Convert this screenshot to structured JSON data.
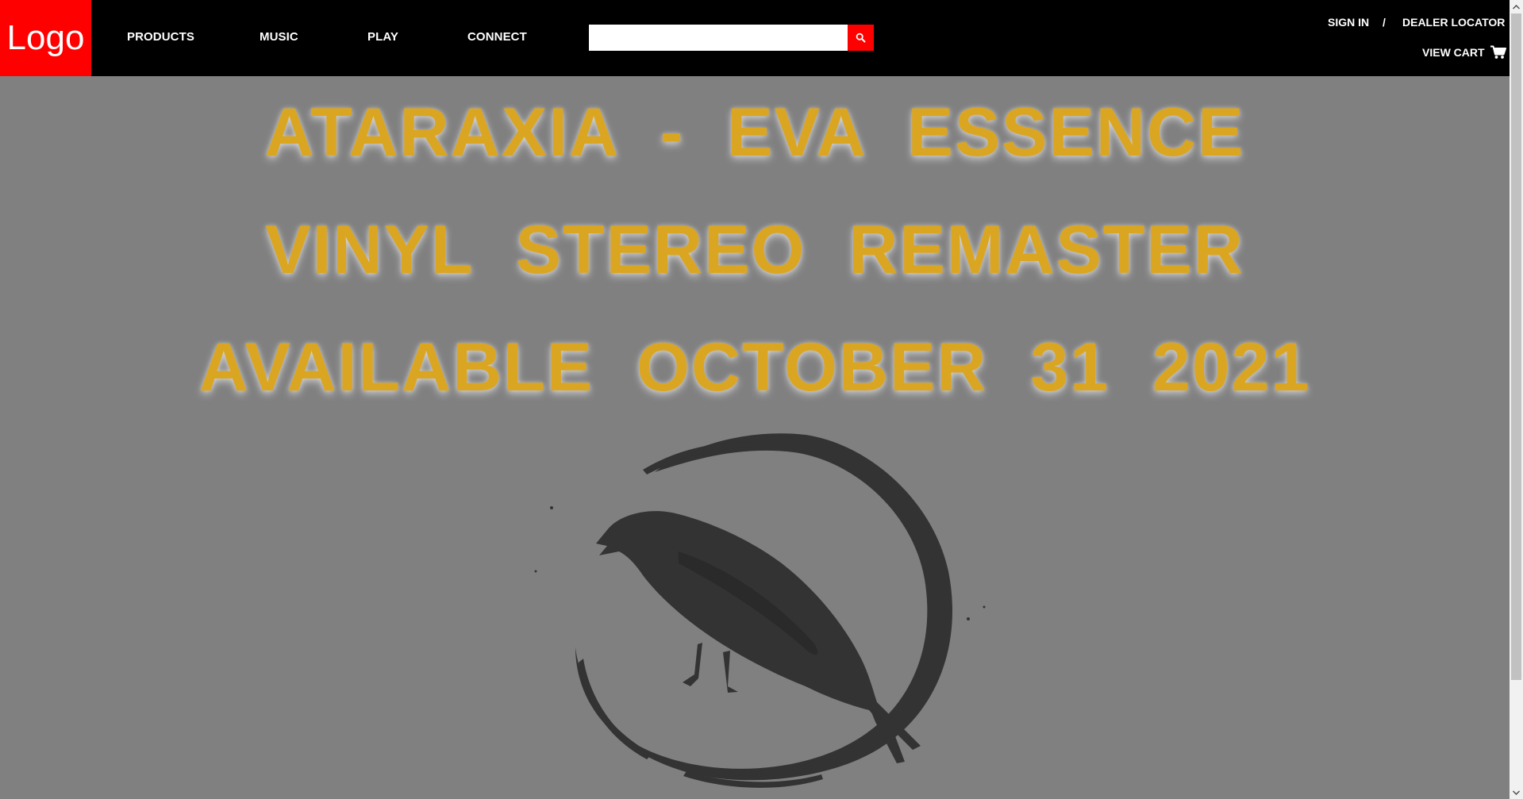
{
  "header": {
    "logo_text": "Logo",
    "nav": [
      "PRODUCTS",
      "MUSIC",
      "PLAY",
      "CONNECT"
    ],
    "search": {
      "value": "",
      "placeholder": "",
      "icon": "search-icon"
    },
    "sign_in": "SIGN IN",
    "separator": "/",
    "dealer_locator": "DEALER LOCATOR",
    "view_cart": "VIEW CART",
    "cart_icon": "cart-icon"
  },
  "hero": {
    "lines": [
      "ATARAXIA - EVA ESSENCE",
      "VINYL STEREO REMASTER",
      "AVAILABLE OCTOBER 31 2021"
    ],
    "artwork": "bird-in-circle-illustration"
  },
  "colors": {
    "header_bg": "#000000",
    "accent": "#ff0000",
    "page_bg": "#808080",
    "headline": "#DAA520",
    "artwork": "#333333"
  }
}
